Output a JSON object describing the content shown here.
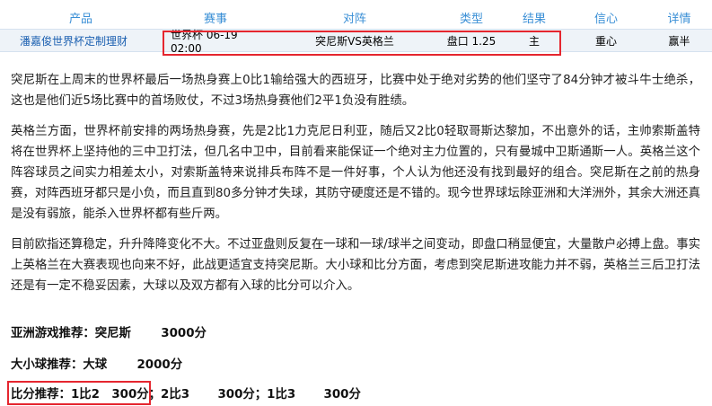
{
  "table": {
    "headers": [
      "产品",
      "赛事",
      "对阵",
      "类型",
      "结果",
      "信心",
      "详情"
    ],
    "row": {
      "product": "潘嘉俊世界杯定制理财",
      "event": "世界杯 06-19 02:00",
      "match": "突尼斯VS英格兰",
      "type": "盘口 1.25",
      "result": "主",
      "confidence": "重心",
      "detail": "赢半"
    }
  },
  "article": {
    "paragraphs": [
      "突尼斯在上周末的世界杯最后一场热身赛上0比1输给强大的西班牙，比赛中处于绝对劣势的他们坚守了84分钟才被斗牛士绝杀，这也是他们近5场比赛中的首场败仗，不过3场热身赛他们2平1负没有胜绩。",
      "英格兰方面，世界杯前安排的两场热身赛，先是2比1力克尼日利亚，随后又2比0轻取哥斯达黎加，不出意外的话，主帅索斯盖特将在世界杯上坚持他的三中卫打法，但几名中卫中，目前看来能保证一个绝对主力位置的，只有曼城中卫斯通斯一人。英格兰这个阵容球员之间实力相差太小，对索斯盖特来说排兵布阵不是一件好事，个人认为他还没有找到最好的组合。突尼斯在之前的热身赛，对阵西班牙都只是小负，而且直到80多分钟才失球，其防守硬度还是不错的。现今世界球坛除亚洲和大洋洲外，其余大洲还真是没有弱旅，能杀入世界杯都有些斤两。",
      "目前欧指还算稳定，升升降降变化不大。不过亚盘则反复在一球和一球/球半之间变动，即盘口稍显便宜，大量散户必搏上盘。事实上英格兰在大赛表现也向来不好，此战更适宜支持突尼斯。大小球和比分方面，考虑到突尼斯进攻能力并不弱，英格兰三后卫打法还是有一定不稳妥因素，大球以及双方都有入球的比分可以介入。"
    ]
  },
  "recommendations": {
    "asian": {
      "label": "亚洲游戏推荐：突尼斯",
      "points": "3000分"
    },
    "total": {
      "label": "大小球推荐：大球",
      "points": "2000分"
    },
    "score": {
      "label": "比分推荐：1比2",
      "points1": "300分；2比3",
      "points2": "300分；1比3",
      "points3": "300分"
    }
  },
  "colors": {
    "header_text": "#3a8fd6",
    "highlight_box": "#e5262f",
    "row_bg": "#eef3f8"
  }
}
